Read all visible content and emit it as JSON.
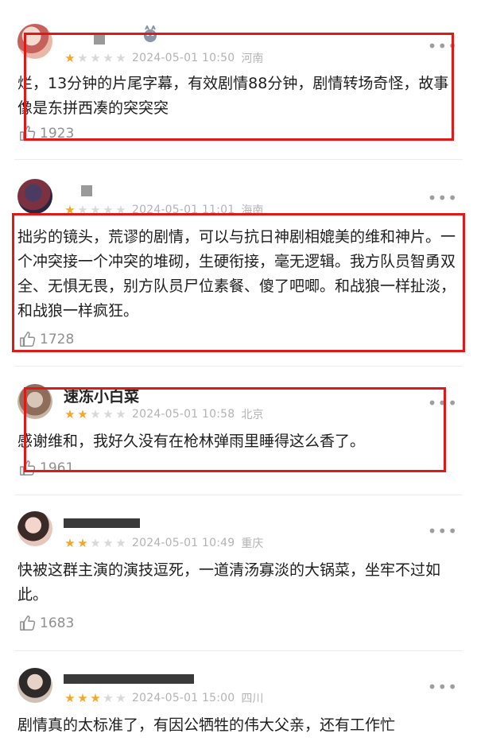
{
  "reviews": [
    {
      "name": "",
      "rating": 1,
      "timestamp": "2024-05-01 10:50",
      "location": "河南",
      "text": "烂，13分钟的片尾字幕，有效剧情88分钟，剧情转场奇怪，故事像是东拼西凑的突突突",
      "likes": "1923",
      "more_icon": "more-dots-icon"
    },
    {
      "name": "",
      "rating": 1,
      "timestamp": "2024-05-01 11:01",
      "location": "海南",
      "text": "拙劣的镜头，荒谬的剧情，可以与抗日神剧相媲美的维和神片。一个冲突接一个冲突的堆砌，生硬衔接，毫无逻辑。我方队员智勇双全、无惧无畏，别方队员尸位素餐、傻了吧唧。和战狼一样扯淡，和战狼一样疯狂。",
      "likes": "1728",
      "more_icon": "more-dots-icon"
    },
    {
      "name": "速冻小白菜",
      "rating": 2,
      "timestamp": "2024-05-01 10:58",
      "location": "北京",
      "text": "感谢维和，我好久没有在枪林弹雨里睡得这么香了。",
      "likes": "1961",
      "more_icon": "more-dots-icon"
    },
    {
      "name": "",
      "rating": 2,
      "timestamp": "2024-05-01 10:49",
      "location": "重庆",
      "text": "快被这群主演的演技逗死，一道清汤寡淡的大锅菜，坐牢不过如此。",
      "likes": "1683",
      "more_icon": "more-dots-icon"
    },
    {
      "name": "",
      "rating": 3,
      "timestamp": "2024-05-01 15:00",
      "location": "四川",
      "text": "剧情真的太标准了，有因公牺牲的伟大父亲，还有工作忙",
      "likes": "",
      "more_icon": "more-dots-icon"
    }
  ],
  "colors": {
    "star_on": "#f5a623",
    "star_off": "#d9d9d9",
    "meta_text": "#b3b3b3",
    "annotation_box": "#e01818"
  }
}
